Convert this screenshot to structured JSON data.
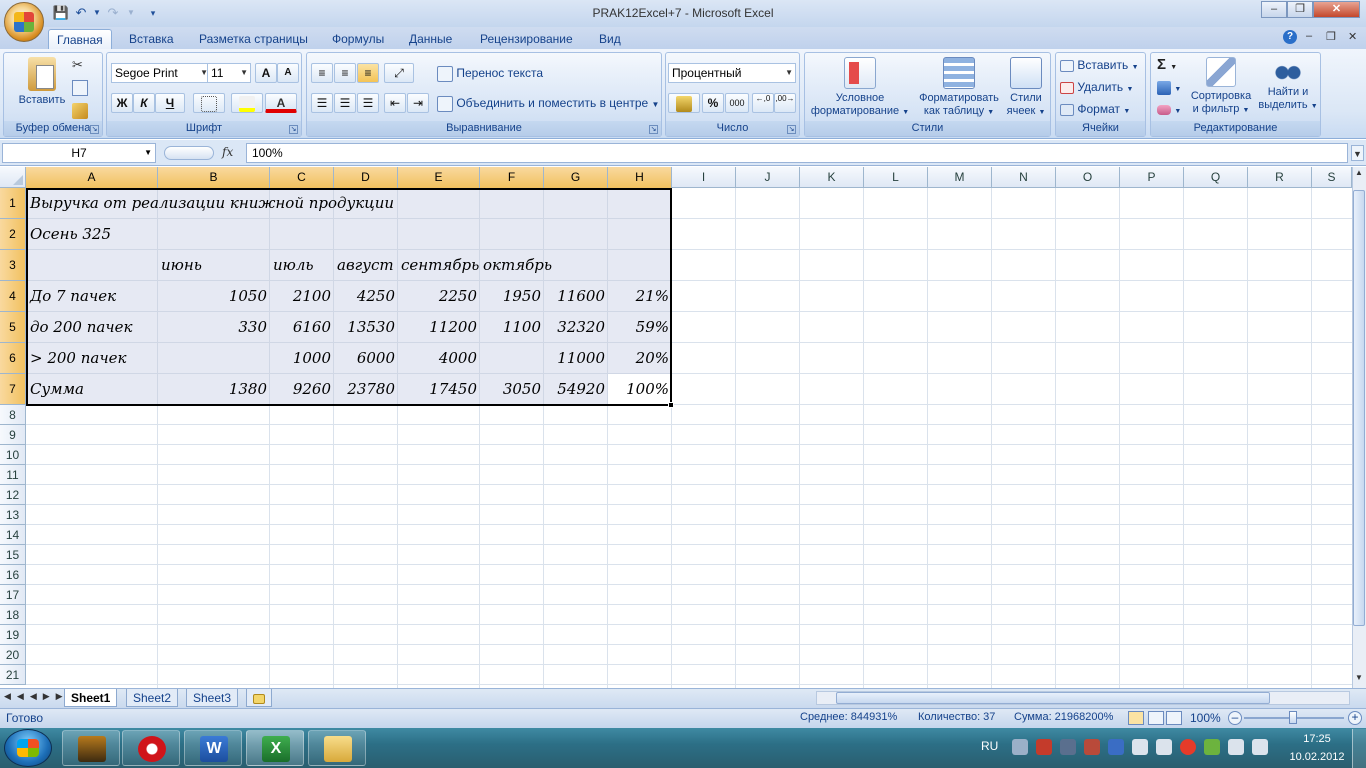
{
  "window": {
    "title": "PRAK12Excel+7 - Microsoft Excel"
  },
  "tabs": [
    "Главная",
    "Вставка",
    "Разметка страницы",
    "Формулы",
    "Данные",
    "Рецензирование",
    "Вид"
  ],
  "ribbon": {
    "clipboard": {
      "label": "Буфер обмена",
      "paste": "Вставить"
    },
    "font": {
      "label": "Шрифт",
      "name": "Segoe Print",
      "size": "11",
      "bold": "Ж",
      "italic": "К",
      "underline": "Ч",
      "grow": "A",
      "shrink": "A"
    },
    "alignment": {
      "label": "Выравнивание",
      "wrap": "Перенос текста",
      "merge": "Объединить и поместить в центре"
    },
    "number": {
      "label": "Число",
      "format": "Процентный",
      "percent": "%",
      "thousands": "000",
      "inc_dec": ",0\n,00",
      "dec_dec": ",00\n,0"
    },
    "styles": {
      "label": "Стили",
      "conditional_l1": "Условное",
      "conditional_l2": "форматирование",
      "table_l1": "Форматировать",
      "table_l2": "как таблицу",
      "cell_l1": "Стили",
      "cell_l2": "ячеек"
    },
    "cells": {
      "label": "Ячейки",
      "insert": "Вставить",
      "delete": "Удалить",
      "format": "Формат"
    },
    "editing": {
      "label": "Редактирование",
      "sort_l1": "Сортировка",
      "sort_l2": "и фильтр",
      "find_l1": "Найти и",
      "find_l2": "выделить",
      "sigma": "Σ"
    }
  },
  "formula_bar": {
    "name_box": "H7",
    "fx": "fx",
    "value": "100%"
  },
  "columns": [
    "A",
    "B",
    "C",
    "D",
    "E",
    "F",
    "G",
    "H",
    "I",
    "J",
    "K",
    "L",
    "M",
    "N",
    "O",
    "P",
    "Q",
    "R",
    "S"
  ],
  "rows": [
    "1",
    "2",
    "3",
    "4",
    "5",
    "6",
    "7",
    "8",
    "9",
    "10",
    "11",
    "12",
    "13",
    "14",
    "15",
    "16",
    "17",
    "18",
    "19",
    "20",
    "21"
  ],
  "cells": {
    "r1": {
      "a": "Выручка от реализации книжной продукции"
    },
    "r2": {
      "a": "Осень 325"
    },
    "r3": {
      "b": "июнь",
      "c": "июль",
      "d": "август",
      "e": "сентябрь",
      "f": "октябрь"
    },
    "r4": {
      "a": "До 7 пачек",
      "b": "1050",
      "c": "2100",
      "d": "4250",
      "e": "2250",
      "f": "1950",
      "g": "11600",
      "h": "21%"
    },
    "r5": {
      "a": "до 200 пачек",
      "b": "330",
      "c": "6160",
      "d": "13530",
      "e": "11200",
      "f": "1100",
      "g": "32320",
      "h": "59%"
    },
    "r6": {
      "a": "> 200 пачек",
      "c": "1000",
      "d": "6000",
      "e": "4000",
      "g": "11000",
      "h": "20%"
    },
    "r7": {
      "a": "Сумма",
      "b": "1380",
      "c": "9260",
      "d": "23780",
      "e": "17450",
      "f": "3050",
      "g": "54920",
      "h": "100%"
    }
  },
  "sheets": [
    "Sheet1",
    "Sheet2",
    "Sheet3"
  ],
  "status": {
    "ready": "Готово",
    "average": "Среднее: 844931%",
    "count": "Количество: 37",
    "sum": "Сумма: 21968200%",
    "zoom": "100%"
  },
  "taskbar": {
    "lang": "RU",
    "time": "17:25",
    "date": "10.02.2012"
  }
}
